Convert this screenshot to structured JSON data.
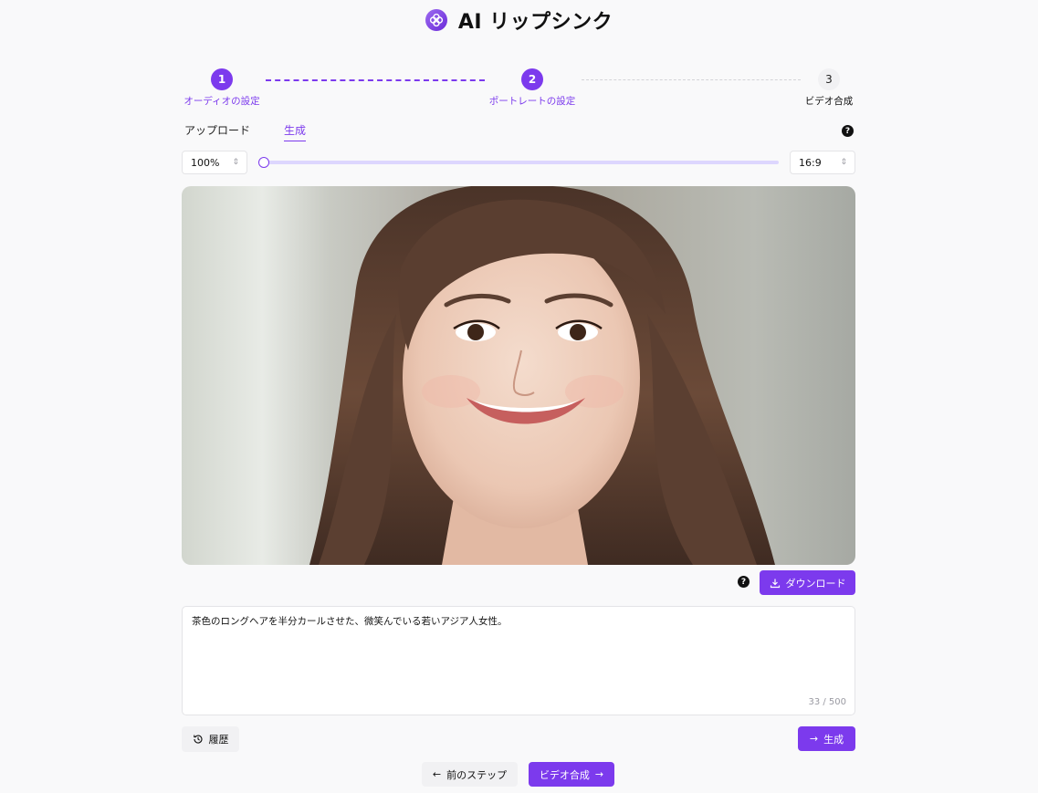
{
  "header": {
    "title": "AI リップシンク",
    "logo_icon": "flower-logo-icon"
  },
  "stepper": {
    "steps": [
      {
        "number": "1",
        "label": "オーディオの設定",
        "state": "done"
      },
      {
        "number": "2",
        "label": "ポートレートの設定",
        "state": "current"
      },
      {
        "number": "3",
        "label": "ビデオ合成",
        "state": "upcoming"
      }
    ]
  },
  "tabs": [
    {
      "label": "アップロード",
      "active": false
    },
    {
      "label": "生成",
      "active": true
    }
  ],
  "controls": {
    "zoom": "100%",
    "zoom_level": 0,
    "aspect_ratio": "16:9"
  },
  "actions": {
    "help_glyph": "?",
    "download_label": "ダウンロード",
    "history_label": "履歴",
    "generate_label": "生成",
    "prev_step_label": "前のステップ",
    "next_step_label": "ビデオ合成"
  },
  "prompt": {
    "value": "茶色のロングヘアを半分カールさせた、微笑んでいる若いアジア人女性。",
    "counter": "33 / 500"
  },
  "colors": {
    "accent": "#7c3aed",
    "accent_light": "#ddd6fe",
    "background": "#f9f9fa"
  }
}
